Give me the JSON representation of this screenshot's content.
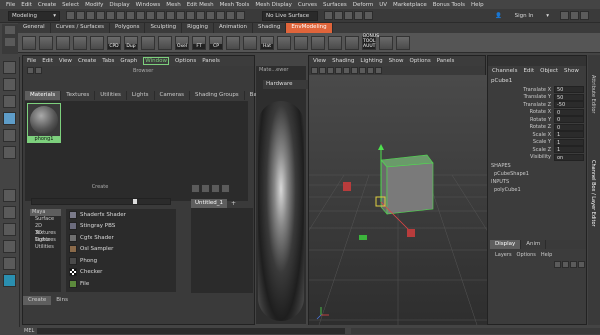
{
  "menu": [
    "File",
    "Edit",
    "Create",
    "Select",
    "Modify",
    "Display",
    "Windows",
    "Mesh",
    "Edit Mesh",
    "Mesh Tools",
    "Mesh Display",
    "Curves",
    "Surfaces",
    "Deform",
    "UV",
    "Marketplace",
    "Bonus Tools",
    "Help"
  ],
  "status": {
    "mode": "Modeling",
    "live_surface": "No Live Surface",
    "sign_in": "Sign In"
  },
  "shelf": {
    "tabs": [
      "General",
      "Curves / Surfaces",
      "Polygons",
      "Sculpting",
      "Rigging",
      "Animation",
      "Shading",
      "EnvModeling"
    ],
    "active_tab": "EnvModeling",
    "button_labels": [
      "CPD",
      "Dup",
      "Oxel",
      "FT",
      "CP",
      "Hat",
      "BONUS TOOL AUUT"
    ]
  },
  "hypershade": {
    "menu": [
      "File",
      "Edit",
      "View",
      "Create",
      "Tabs",
      "Graph",
      "Window",
      "Options",
      "Panels"
    ],
    "browser_title": "Browser",
    "browser_tabs": [
      "Materials",
      "Textures",
      "Utilities",
      "Lights",
      "Cameras",
      "Shading Groups",
      "Bak"
    ],
    "active_browser_tab": "Materials",
    "material": "phong1",
    "create_title": "Create",
    "create_tree": [
      "Maya",
      "Surface",
      "2D Textures",
      "3D Textures",
      "Lights",
      "Utilities"
    ],
    "create_nodes": [
      {
        "name": "Shaderfx Shader",
        "color": "#7a7a8a"
      },
      {
        "name": "Stingray PBS",
        "color": "#6c6c7e"
      },
      {
        "name": "Cgfx Shader",
        "color": "#707070"
      },
      {
        "name": "Osl Sampler",
        "color": "#8a6a4a"
      },
      {
        "name": "Phong",
        "color": "#4a4a4a"
      },
      {
        "name": "Checker",
        "color": "#ffffff"
      },
      {
        "name": "File",
        "color": "#5c8a3c"
      }
    ],
    "bottom_tabs": [
      "Create",
      "Bins"
    ],
    "editor_tab": "Untitled_1",
    "editor_add": "+"
  },
  "material_viewer": {
    "title": "Mate...ewer",
    "mode": "Hardware"
  },
  "viewport": {
    "menu": [
      "View",
      "Shading",
      "Lighting",
      "Show",
      "Options",
      "Panels"
    ]
  },
  "channel_box": {
    "menu": [
      "Channels",
      "Edit",
      "Object",
      "Show"
    ],
    "object": "pCube1",
    "attributes": [
      {
        "name": "Translate X",
        "value": "50"
      },
      {
        "name": "Translate Y",
        "value": "50"
      },
      {
        "name": "Translate Z",
        "value": "-50"
      },
      {
        "name": "Rotate X",
        "value": "0"
      },
      {
        "name": "Rotate Y",
        "value": "0"
      },
      {
        "name": "Rotate Z",
        "value": "0"
      },
      {
        "name": "Scale X",
        "value": "1"
      },
      {
        "name": "Scale Y",
        "value": "1"
      },
      {
        "name": "Scale Z",
        "value": "1"
      },
      {
        "name": "Visibility",
        "value": "on"
      }
    ],
    "shapes_label": "SHAPES",
    "shape": "pCubeShape1",
    "inputs_label": "INPUTS",
    "input": "polyCube1",
    "side_tabs": [
      "Attribute Editor",
      "Channel Box / Layer Editor"
    ]
  },
  "layer_editor": {
    "tabs": [
      "Display",
      "Anim"
    ],
    "menu": [
      "Layers",
      "Options",
      "Help"
    ]
  },
  "command_line": {
    "label": "MEL"
  }
}
